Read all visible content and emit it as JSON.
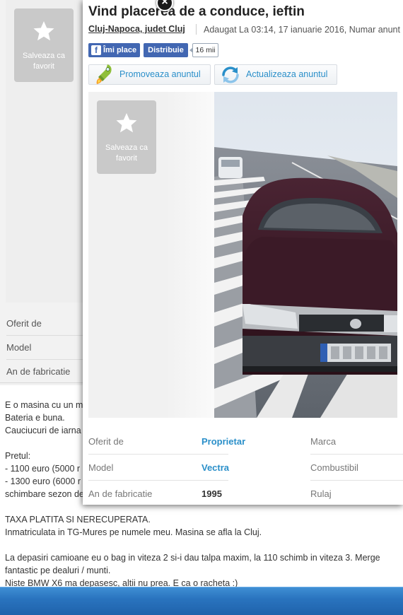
{
  "favorite": {
    "label": "Salveaza ca favorit"
  },
  "background": {
    "rows": [
      {
        "label": "Oferit de"
      },
      {
        "label": "Model"
      },
      {
        "label": "An de fabricatie"
      }
    ],
    "description_lines": [
      "E o masina cu un m",
      "Bateria e buna.",
      "Cauciucuri de iarna",
      "",
      "Pretul:",
      "- 1100 euro (5000 r",
      "- 1300 euro (6000 r",
      "schimbare sezon de",
      "",
      "TAXA PLATITA SI NERECUPERATA.",
      "Inmatriculata in TG-Mures pe numele meu. Masina se afla la Cluj.",
      "",
      "La depasiri camioane eu o bag in viteza 2 si-i dau talpa maxim, la 110 schimb in viteza 3. Merge",
      "fantastic pe dealuri / munti.",
      "Niste BMW X6 ma depasesc, altii nu prea. E ca o racheta :)"
    ]
  },
  "modal": {
    "close_glyph": "×",
    "title": "Vind placerea de a conduce, ieftin",
    "location": "Cluj-Napoca, judet Cluj",
    "added": "Adaugat La 03:14, 17 ianuarie 2016, Numar anunt",
    "facebook": {
      "like_icon": "f",
      "like": "Îmi place",
      "share": "Distribuie",
      "count": "16 mii"
    },
    "actions": {
      "promote": "Promoveaza anuntul",
      "update": "Actualizeaza anuntul"
    },
    "specs": [
      {
        "label": "Oferit de",
        "value": "Proprietar",
        "right_label": "Marca"
      },
      {
        "label": "Model",
        "value": "Vectra",
        "right_label": "Combustibil"
      },
      {
        "label": "An de fabricatie",
        "value": "1995",
        "right_label": "Rulaj"
      }
    ]
  },
  "colors": {
    "link": "#2a8fc9",
    "facebook": "#4267b2",
    "car": "#3e1e2a"
  },
  "icons": [
    "star-icon",
    "rocket-icon",
    "refresh-icon",
    "facebook-icon",
    "close-icon"
  ]
}
